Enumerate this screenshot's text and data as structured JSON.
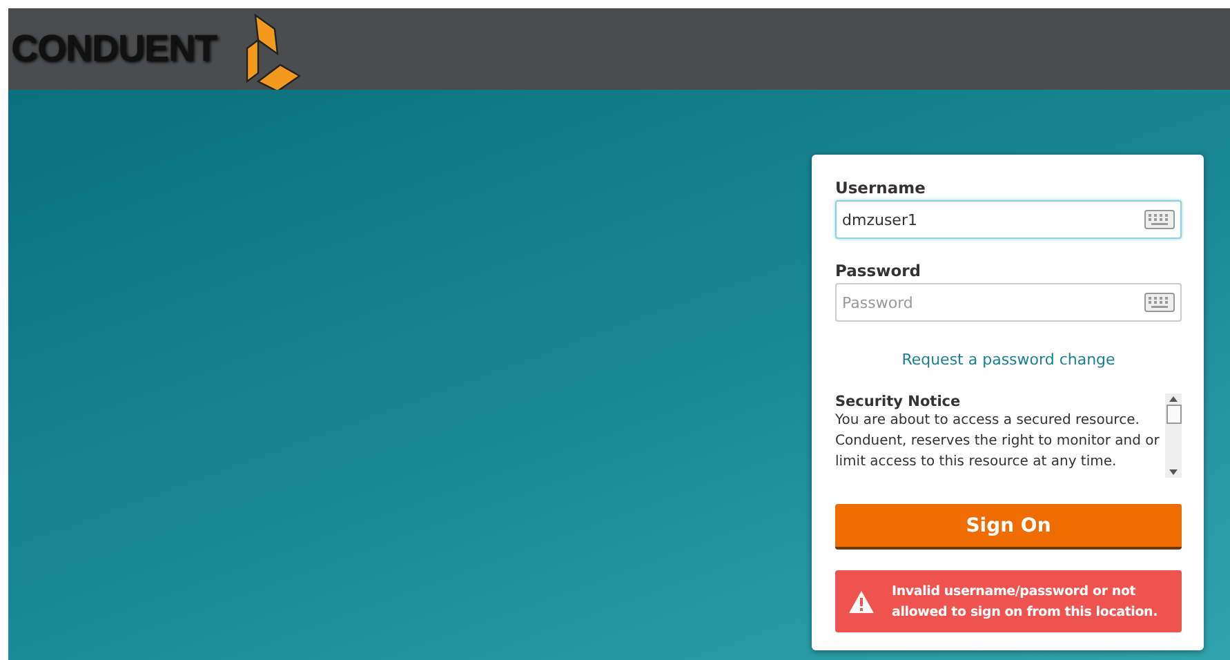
{
  "header": {
    "logo_text": "CONDUENT"
  },
  "login": {
    "username": {
      "label": "Username",
      "value": "dmzuser1",
      "focused": true
    },
    "password": {
      "label": "Password",
      "placeholder": "Password"
    },
    "password_change_link": "Request a password change",
    "security_notice": {
      "title": "Security Notice",
      "text": "You are about to access a secured resource. Conduent, reserves the right to monitor and or limit access to this resource at any time."
    },
    "sign_on_button": "Sign On",
    "error": "Invalid username/password or not allowed to sign on from this location."
  }
}
